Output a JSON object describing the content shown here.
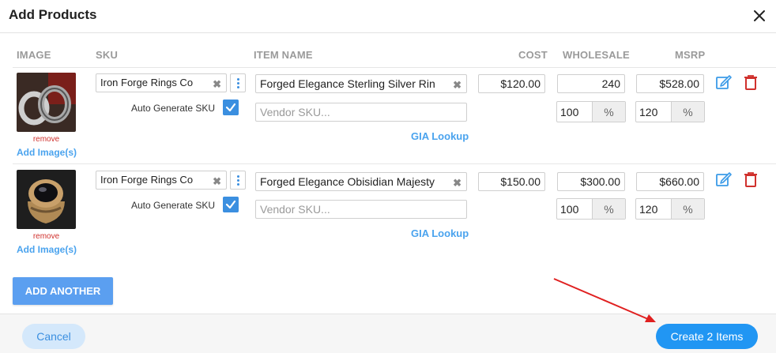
{
  "modal": {
    "title": "Add Products"
  },
  "columns": {
    "image": "IMAGE",
    "sku": "SKU",
    "item_name": "ITEM NAME",
    "cost": "COST",
    "wholesale": "WHOLESALE",
    "msrp": "MSRP"
  },
  "rows": [
    {
      "image_alt": "silver rings",
      "remove": "remove",
      "add_images": "Add Image(s)",
      "sku": "Iron Forge Rings Co",
      "auto_generate_label": "Auto Generate SKU",
      "auto_generate_checked": true,
      "item_name": "Forged Elegance Sterling Silver Rin",
      "vendor_sku_placeholder": "Vendor SKU...",
      "gia_lookup": "GIA Lookup",
      "cost": "$120.00",
      "wholesale": "240",
      "msrp": "$528.00",
      "wholesale_pct": "100",
      "msrp_pct": "120",
      "pct_symbol": "%"
    },
    {
      "image_alt": "obsidian ring",
      "remove": "remove",
      "add_images": "Add Image(s)",
      "sku": "Iron Forge Rings Co",
      "auto_generate_label": "Auto Generate SKU",
      "auto_generate_checked": true,
      "item_name": "Forged Elegance Obisidian Majesty",
      "vendor_sku_placeholder": "Vendor SKU...",
      "gia_lookup": "GIA Lookup",
      "cost": "$150.00",
      "wholesale": "$300.00",
      "msrp": "$660.00",
      "wholesale_pct": "100",
      "msrp_pct": "120",
      "pct_symbol": "%"
    }
  ],
  "actions": {
    "add_another": "ADD ANOTHER",
    "cancel": "Cancel",
    "create": "Create 2 Items"
  },
  "colors": {
    "accent": "#2196f3",
    "link": "#4aa3ee",
    "danger": "#d0312d",
    "annotation_arrow": "#e02020"
  },
  "icons": {
    "close": "close-icon",
    "edit": "edit-icon",
    "delete": "trash-icon",
    "more": "kebab-menu-icon",
    "clear": "clear-x-icon",
    "check": "checkmark-icon"
  }
}
